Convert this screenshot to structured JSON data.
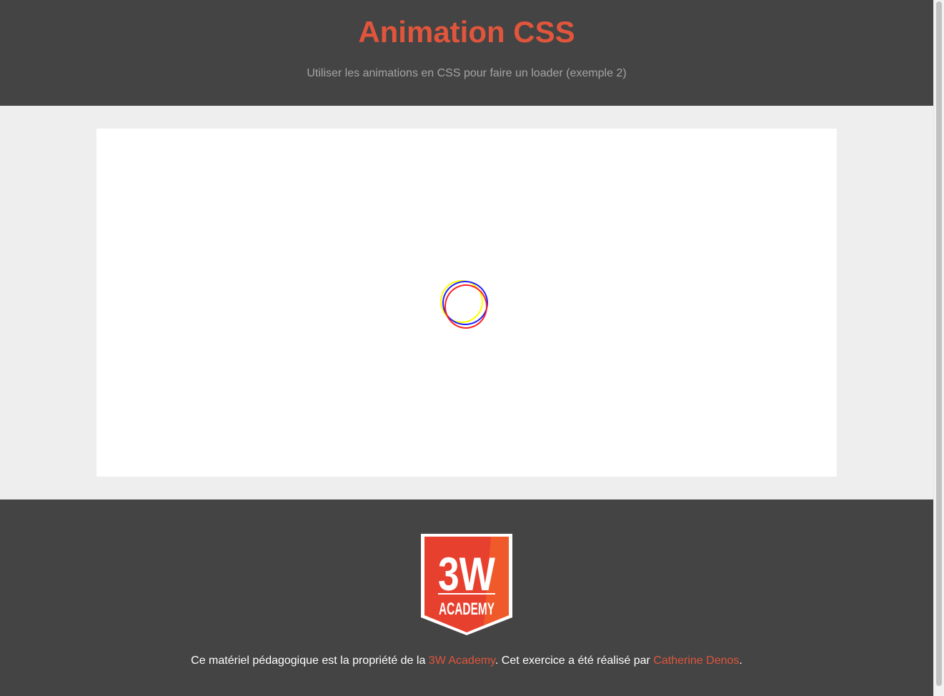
{
  "header": {
    "title": "Animation CSS",
    "subtitle": "Utiliser les animations en CSS pour faire un loader (exemple 2)"
  },
  "loader": {
    "icon": "loader-rings-icon",
    "ring_colors": [
      "#ffff00",
      "#1f1fff",
      "#ff1f1f"
    ]
  },
  "footer": {
    "logo": {
      "icon": "3w-academy-logo-icon",
      "line1": "3W",
      "line2": "ACADEMY"
    },
    "credits": {
      "text_before": "Ce matériel pédagogique est la propriété de la ",
      "link1": "3W Academy",
      "text_middle": ". Cet exercice a été réalisé par ",
      "link2": "Catherine Denos",
      "text_after": "."
    }
  },
  "colors": {
    "accent": "#e0553c",
    "dark_bg": "#444444",
    "light_bg": "#eeeeee",
    "subtitle_text": "#a4a4a4",
    "logo_red": "#e8402e",
    "logo_orange": "#f0592a"
  }
}
